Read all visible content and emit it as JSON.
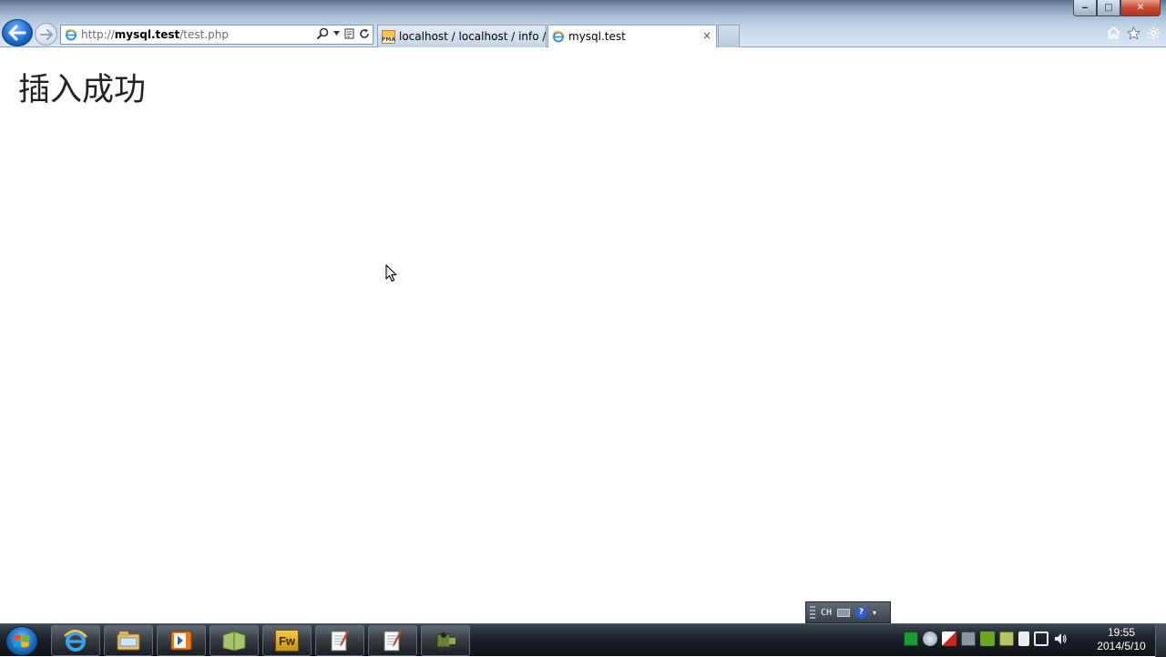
{
  "browser": {
    "address": {
      "scheme": "http://",
      "host": "mysql.test",
      "path": "/test.php"
    },
    "tabs": [
      {
        "label": "localhost / localhost / info /...",
        "icon": "phpmyadmin-icon",
        "active": false
      },
      {
        "label": "mysql.test",
        "icon": "ie-page-icon",
        "active": true
      }
    ],
    "caption": {
      "minimize": "‒",
      "maximize": "□",
      "close": "✕"
    },
    "tab_close": "×",
    "toolbar_icons": [
      "home-icon",
      "favorites-star-icon",
      "settings-gear-icon"
    ]
  },
  "page": {
    "heading": "插入成功"
  },
  "ime": {
    "language": "CH",
    "help": "?"
  },
  "taskbar": {
    "apps": [
      "ie-icon",
      "explorer-icon",
      "media-player-icon",
      "book-icon",
      "fireworks-icon",
      "notepad-icon",
      "notepad-icon",
      "capture-icon"
    ],
    "fireworks_label": "Fw",
    "clock": {
      "time": "19:55",
      "date": "2014/5/10"
    }
  },
  "colors": {
    "accent_blue": "#1964c4",
    "taskbar": "#1b2027",
    "page_background": "#ffffff"
  }
}
